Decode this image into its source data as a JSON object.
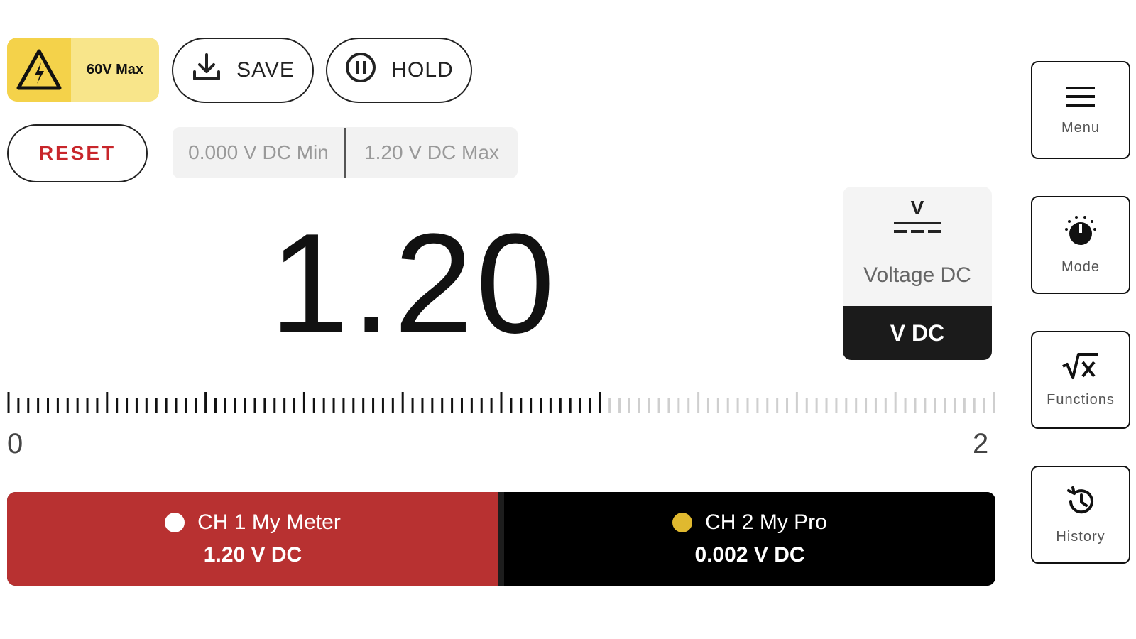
{
  "warning": {
    "label": "60V Max",
    "icon": "high-voltage-warning-icon"
  },
  "toolbar": {
    "save_label": "SAVE",
    "save_icon": "download-icon",
    "hold_label": "HOLD",
    "hold_icon": "pause-circle-icon",
    "reset_label": "RESET"
  },
  "minmax": {
    "min": "0.000 V DC Min",
    "max": "1.20 V DC Max"
  },
  "reading": {
    "value": "1.20"
  },
  "mode_card": {
    "symbol_letter": "V",
    "symbol_icon": "dc-voltage-icon",
    "name": "Voltage DC",
    "unit": "V DC"
  },
  "scale": {
    "min": "0",
    "max": "2",
    "level": 0.6
  },
  "channels": [
    {
      "label": "CH 1 My Meter",
      "value": "1.20 V DC",
      "dot_color": "#ffffff",
      "bg": "#b83131"
    },
    {
      "label": "CH 2 My Pro",
      "value": "0.002 V DC",
      "dot_color": "#e0b92f",
      "bg": "#000000"
    }
  ],
  "sidebar": [
    {
      "label": "Menu",
      "icon": "hamburger-menu-icon"
    },
    {
      "label": "Mode",
      "icon": "dial-knob-icon"
    },
    {
      "label": "Functions",
      "icon": "square-root-icon"
    },
    {
      "label": "History",
      "icon": "history-clock-icon"
    }
  ],
  "colors": {
    "accent_red": "#c8262b",
    "warning_yellow": "#f4d24a",
    "ch1_red": "#b83131",
    "ch2_dot": "#e0b92f"
  }
}
